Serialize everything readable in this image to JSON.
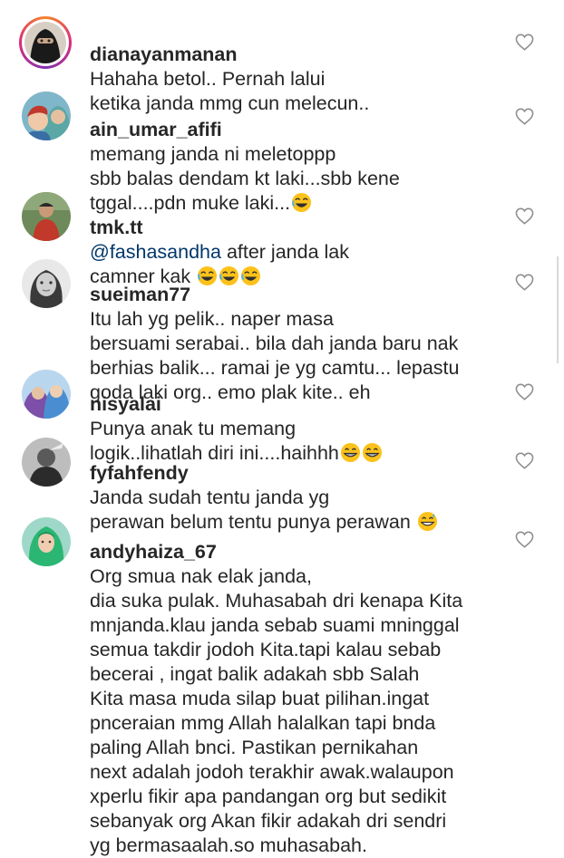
{
  "comments": [
    {
      "username": "dianayanmanan",
      "text": "Hahaha betol.. Pernah lalui\nketika janda mmg cun melecun..",
      "avatar": "niqab-person-avatar",
      "has_story_ring": true
    },
    {
      "username": "ain_umar_afifi",
      "text": "memang janda ni meletoppp\nsbb balas dendam kt laki...sbb kene\ntggal....pdn muke laki...",
      "emoji": [
        "laughing-emoji"
      ],
      "avatar": "mother-child-avatar"
    },
    {
      "username": "tmk.tt",
      "mention": "@fashasandha",
      "text": " after janda lak\ncamner kak ",
      "emoji": [
        "laughing-emoji",
        "laughing-emoji",
        "laughing-emoji"
      ],
      "avatar": "man-red-shirt-avatar"
    },
    {
      "username": "sueiman77",
      "text": "Itu lah yg pelik.. naper masa\nbersuami serabai.. bila dah janda baru nak\nberhias balik... ramai je yg camtu... lepastu\ngoda laki org.. emo plak kite.. eh",
      "avatar": "woman-bw-avatar"
    },
    {
      "username": "nisyalai",
      "text": "Punya anak tu memang\nlogik..lihatlah diri ini....haihhh",
      "emoji": [
        "grinning-emoji",
        "grinning-emoji"
      ],
      "avatar": "two-women-avatar"
    },
    {
      "username": "fyfahfendy",
      "text": "Janda sudah tentu janda yg\nperawan belum tentu punya perawan ",
      "emoji": [
        "sweat-smile-emoji"
      ],
      "avatar": "person-bw-avatar"
    },
    {
      "username": "andyhaiza_67",
      "text": "Org smua nak elak janda,\ndia suka pulak. Muhasabah dri kenapa Kita\nmnjanda.klau janda sebab suami mninggal\nsemua takdir jodoh Kita.tapi kalau sebab\nbecerai , ingat balik adakah sbb Salah\nKita masa muda silap buat pilihan.ingat\npnceraian mmg Allah halalkan tapi bnda\npaling Allah bnci. Pastikan pernikahan\nnext adalah jodoh terakhir awak.walaupon\nxperlu fikir apa pandangan org but sedikit\nsebanyak org Akan fikir adakah dri sendri\nyg bermasaalah.so muhasabah.",
      "avatar": "woman-green-hijab-avatar"
    }
  ],
  "icons": {
    "like": "heart-outline-icon"
  },
  "colors": {
    "text": "#262626",
    "mention": "#00376b",
    "heart_outline": "#8e8e8e"
  }
}
